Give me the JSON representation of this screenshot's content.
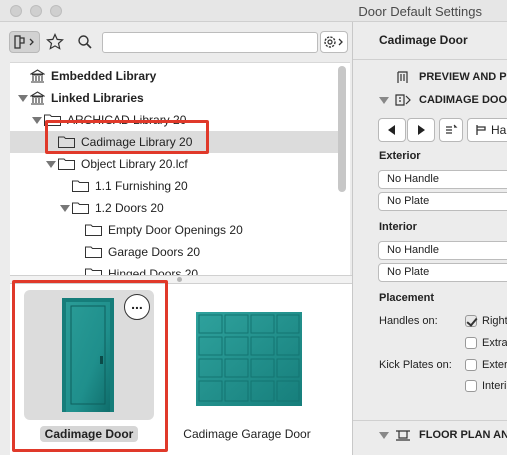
{
  "window": {
    "title": "Door Default Settings"
  },
  "search": {
    "placeholder": "",
    "value": ""
  },
  "tree": {
    "items": [
      {
        "label": "Embedded Library"
      },
      {
        "label": "Linked Libraries"
      },
      {
        "label": "ARCHICAD Library 20"
      },
      {
        "label": "Cadimage Library 20"
      },
      {
        "label": "Object Library 20.lcf"
      },
      {
        "label": "1.1 Furnishing 20"
      },
      {
        "label": "1.2 Doors 20"
      },
      {
        "label": "Empty Door Openings 20"
      },
      {
        "label": "Garage Doors 20"
      },
      {
        "label": "Hinged Doors 20"
      }
    ]
  },
  "preview": {
    "items": [
      {
        "label": "Cadimage Door",
        "more": "..."
      },
      {
        "label": "Cadimage Garage Door"
      }
    ]
  },
  "right": {
    "title": "Cadimage Door",
    "panels": {
      "preview": "PREVIEW AND POSITIONING",
      "cadimage": "CADIMAGE DOOR SETTINGS",
      "floor": "FLOOR PLAN AND SECTION"
    },
    "handle_button": "Handles",
    "exterior": {
      "label": "Exterior",
      "handle": "No Handle",
      "plate": "No Plate"
    },
    "interior": {
      "label": "Interior",
      "handle": "No Handle",
      "plate": "No Plate"
    },
    "placement": {
      "label": "Placement",
      "handles_on": "Handles on:",
      "kick_plates_on": "Kick Plates on:",
      "opt_right": "Right",
      "opt_extra": "Extra",
      "opt_exterior": "Exterior",
      "opt_interior": "Interior"
    }
  },
  "colors": {
    "highlight": "#e0392a",
    "door_teal": "#1f8f8c"
  }
}
